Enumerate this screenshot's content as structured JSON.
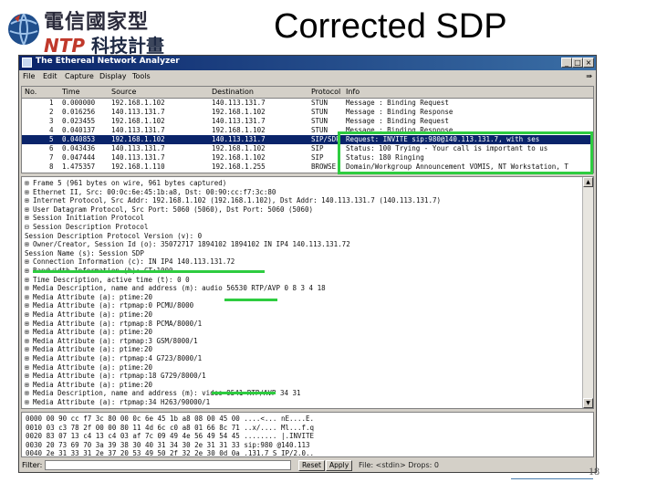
{
  "slide": {
    "title": "Corrected SDP",
    "page_number": "18",
    "logo": {
      "line1": "電信國家型",
      "line2_ntp": "NTP",
      "line2_cn": "科技計畫"
    }
  },
  "window": {
    "title": "The Ethereal Network Analyzer",
    "menu": [
      "File",
      "Edit",
      "Capture",
      "Display",
      "Tools"
    ]
  },
  "packet_list": {
    "columns": [
      "No.",
      "Time",
      "Source",
      "Destination",
      "Protocol",
      "Info"
    ],
    "rows": [
      {
        "no": "1",
        "time": "0.000000",
        "source": "192.168.1.102",
        "destination": "140.113.131.7",
        "protocol": "STUN",
        "info": "Message : Binding Request"
      },
      {
        "no": "2",
        "time": "0.016256",
        "source": "140.113.131.7",
        "destination": "192.168.1.102",
        "protocol": "STUN",
        "info": "Message : Binding Response"
      },
      {
        "no": "3",
        "time": "0.023455",
        "source": "192.168.1.102",
        "destination": "140.113.131.7",
        "protocol": "STUN",
        "info": "Message : Binding Request"
      },
      {
        "no": "4",
        "time": "0.040137",
        "source": "140.113.131.7",
        "destination": "192.168.1.102",
        "protocol": "STUN",
        "info": "Message : Binding Response"
      },
      {
        "no": "5",
        "time": "0.040853",
        "source": "192.168.1.102",
        "destination": "140.113.131.7",
        "protocol": "SIP/SDP",
        "info": "Request: INVITE sip:980@140.113.131.7, with ses"
      },
      {
        "no": "6",
        "time": "0.043436",
        "source": "140.113.131.7",
        "destination": "192.168.1.102",
        "protocol": "SIP",
        "info": "Status: 100 Trying - Your call is important to us"
      },
      {
        "no": "7",
        "time": "0.047444",
        "source": "140.113.131.7",
        "destination": "192.168.1.102",
        "protocol": "SIP",
        "info": "Status: 180 Ringing"
      },
      {
        "no": "8",
        "time": "1.475357",
        "source": "192.168.1.110",
        "destination": "192.168.1.255",
        "protocol": "BROWSE",
        "info": "Domain/Workgroup Announcement VOMIS, NT Workstation, T"
      }
    ],
    "selected_row": 4
  },
  "detail": [
    "⊞ Frame 5 (961 bytes on wire, 961 bytes captured)",
    "⊞ Ethernet II, Src: 00:0c:6e:45:1b:a8, Dst: 00:90:cc:f7:3c:80",
    "⊞ Internet Protocol, Src Addr: 192.168.1.102 (192.168.1.102), Dst Addr: 140.113.131.7 (140.113.131.7)",
    "⊞ User Datagram Protocol, Src Port: 5060 (5060), Dst Port: 5060 (5060)",
    "⊞ Session Initiation Protocol",
    "⊟ Session Description Protocol",
    "    Session Description Protocol Version (v): 0",
    "  ⊞ Owner/Creator, Session Id (o): 35072717 1894102 1894102 IN IP4 140.113.131.72",
    "    Session Name (s): Session SDP",
    "  ⊞ Connection Information (c): IN IP4 140.113.131.72",
    "  ⊞ Bandwidth Information (b): CT:1000",
    "  ⊞ Time Description, active time (t): 0 0",
    "  ⊞ Media Description, name and address (m): audio 56530 RTP/AVP 0 8 3 4 18",
    "  ⊞ Media Attribute (a): ptime:20",
    "  ⊞ Media Attribute (a): rtpmap:0 PCMU/8000",
    "  ⊞ Media Attribute (a): ptime:20",
    "  ⊞ Media Attribute (a): rtpmap:8 PCMA/8000/1",
    "  ⊞ Media Attribute (a): ptime:20",
    "  ⊞ Media Attribute (a): rtpmap:3 GSM/8000/1",
    "  ⊞ Media Attribute (a): ptime:20",
    "  ⊞ Media Attribute (a): rtpmap:4 G723/8000/1",
    "  ⊞ Media Attribute (a): ptime:20",
    "  ⊞ Media Attribute (a): rtpmap:18 G729/8000/1",
    "  ⊞ Media Attribute (a): ptime:20",
    "  ⊞ Media Description, name and address (m): video 9541 RTP/AVP 34 31",
    "  ⊞ Media Attribute (a): rtpmap:34 H263/90000/1"
  ],
  "hex": [
    "0000  00 90 cc f7 3c 80 00 0c  6e 45 1b a8 08 00 45 00   ....<... nE....E.",
    "0010  03 c3 78 2f 00 00 80 11  4d 6c c0 a8 01 66 8c 71   ..x/.... Ml...f.q",
    "0020  83 07 13 c4 13 c4 03 af  7c 09 49 4e 56 49 54 45   ........ |.INVITE",
    "0030  20 73 69 70 3a 39 38 30  40 31 34 30 2e 31 31 33    sip:980 @140.113",
    "0040  2e 31 33 31 2e 37 20 53  49 50 2f 32 2e 30 0d 0a   .131.7 S IP/2.0.."
  ],
  "statusbar": {
    "filter_label": "Filter:",
    "reset_label": "Reset",
    "apply_label": "Apply",
    "status_text": "File: <stdin> Drops: 0"
  },
  "colors": {
    "highlight": "#2ecc40",
    "selection": "#0a246a",
    "titlebar": "#0a246a"
  }
}
